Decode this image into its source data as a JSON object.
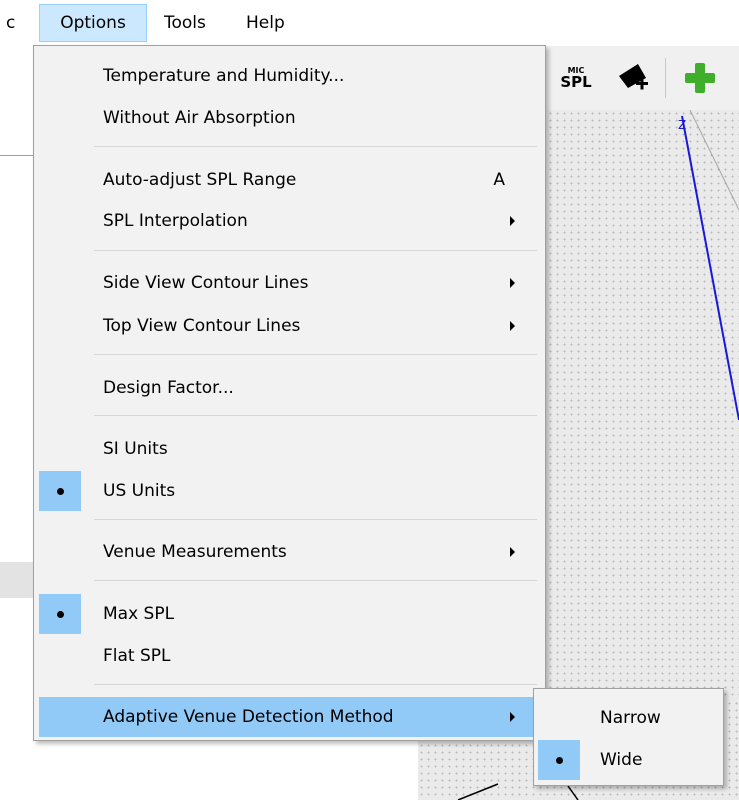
{
  "menubar": {
    "items": [
      {
        "label": "c"
      },
      {
        "label": "Options"
      },
      {
        "label": "Tools"
      },
      {
        "label": "Help"
      }
    ]
  },
  "toolbar": {
    "mic_spl_top": "MIC",
    "mic_spl_bottom": "SPL"
  },
  "viewport": {
    "axis_label": "Z"
  },
  "options_menu": {
    "temperature_humidity": "Temperature and Humidity...",
    "without_air_absorption": "Without Air Absorption",
    "auto_adjust_spl_range": "Auto-adjust SPL Range",
    "auto_adjust_shortcut": "A",
    "spl_interpolation": "SPL Interpolation",
    "side_view_contour_lines": "Side View Contour Lines",
    "top_view_contour_lines": "Top View Contour Lines",
    "design_factor": "Design Factor...",
    "si_units": "SI Units",
    "us_units": "US Units",
    "venue_measurements": "Venue Measurements",
    "max_spl": "Max SPL",
    "flat_spl": "Flat SPL",
    "adaptive_venue_detection": "Adaptive Venue Detection Method"
  },
  "submenu": {
    "narrow": "Narrow",
    "wide": "Wide"
  },
  "colors": {
    "highlight": "#91c9f7",
    "menu_background": "#f2f2f2",
    "active_menubar": "#cce8ff",
    "plus_icon": "#3fae2a",
    "axis_line": "#1a1ad8"
  }
}
